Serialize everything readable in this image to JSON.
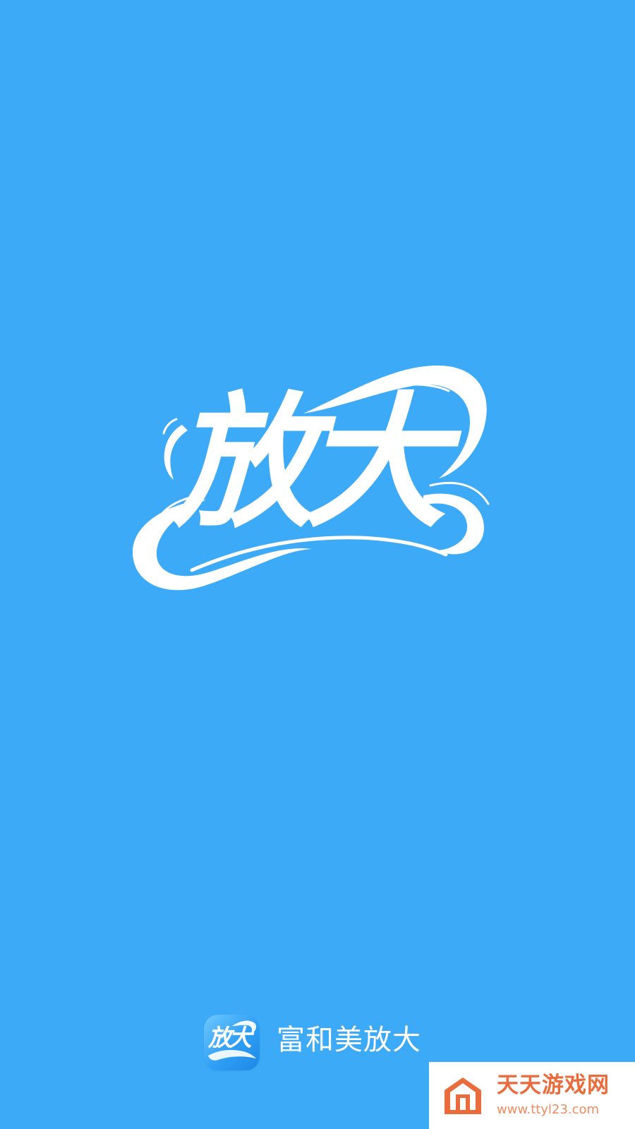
{
  "theme": {
    "background": "#3daaf8",
    "foreground": "#ffffff",
    "watermark_accent": "#ea6b3b"
  },
  "splash": {
    "logo_text": "放大"
  },
  "brand": {
    "icon_text": "放大",
    "name": "富和美放大"
  },
  "watermark": {
    "title": "天天游戏网",
    "url": "www.ttyl23.com",
    "icon": "house-logo-icon"
  }
}
